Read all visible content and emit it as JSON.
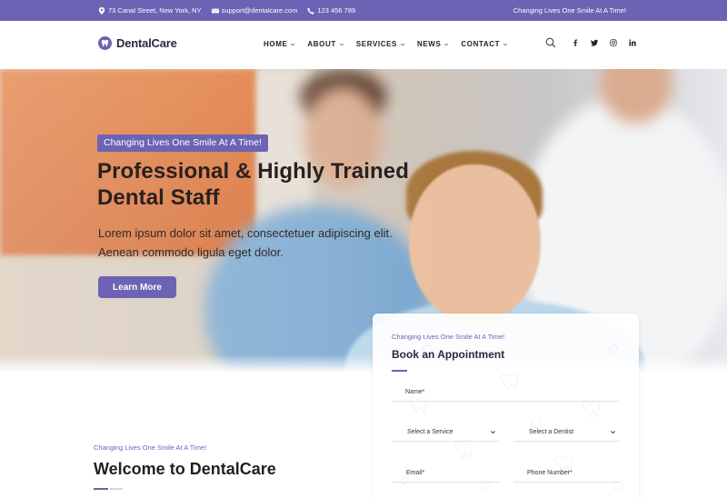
{
  "colors": {
    "accent": "#6c63b5",
    "heading": "#231f20",
    "topbar_text": "#ffffff"
  },
  "topbar": {
    "address": "73 Canal Street, New York, NY",
    "email": "support@dentalcare.com",
    "phone": "123 456 789",
    "tagline": "Changing Lives One Smile At A Time!"
  },
  "header": {
    "logo_text": "DentalCare",
    "logo_icon": "tooth-icon",
    "nav": [
      {
        "label": "HOME"
      },
      {
        "label": "ABOUT"
      },
      {
        "label": "SERVICES"
      },
      {
        "label": "NEWS"
      },
      {
        "label": "CONTACT"
      }
    ],
    "search_icon": "search-icon",
    "socials": [
      "facebook-icon",
      "twitter-icon",
      "instagram-icon",
      "linkedin-icon"
    ]
  },
  "hero": {
    "badge": "Changing Lives One Smile At A Time!",
    "title": "Professional & Highly Trained Dental Staff",
    "description": "Lorem ipsum dolor sit amet, consectetuer adipiscing elit. Aenean commodo ligula eget dolor.",
    "button": "Learn More"
  },
  "appointment": {
    "tagline": "Changing Lives One Smile At A Time!",
    "title": "Book an Appointment",
    "name_placeholder": "Name*",
    "service_selected": "Select a Service",
    "dentist_selected": "Select a Dentist",
    "email_placeholder": "Email*",
    "phone_placeholder": "Phone Number*"
  },
  "welcome": {
    "tagline": "Changing Lives One Smile At A Time!",
    "title": "Welcome to DentalCare"
  }
}
